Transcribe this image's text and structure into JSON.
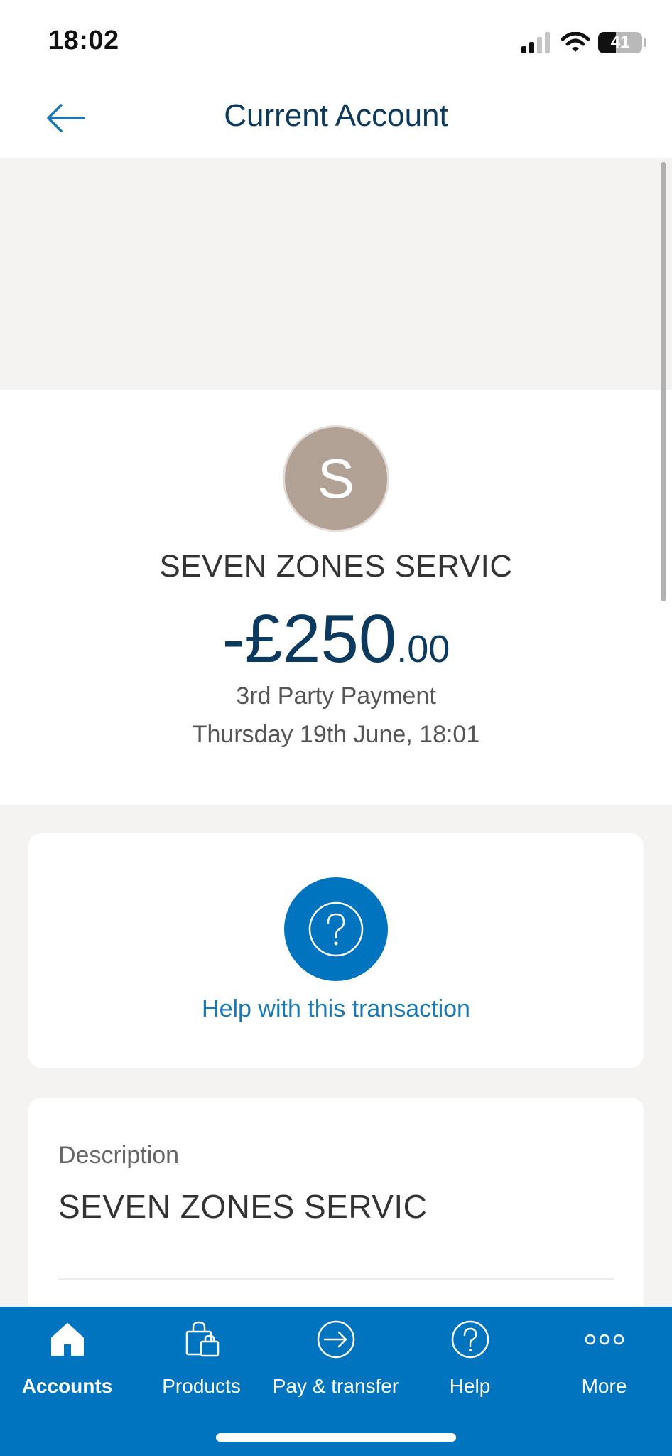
{
  "status_bar": {
    "time": "18:02",
    "battery": "41",
    "battery_level": 0.41
  },
  "header": {
    "title": "Current Account",
    "back_icon": "arrow-left-icon"
  },
  "transaction": {
    "avatar_letter": "S",
    "merchant": "SEVEN ZONES SERVIC",
    "amount_main": "-£250",
    "amount_pence": ".00",
    "type": "3rd Party Payment",
    "date": "Thursday 19th June, 18:01"
  },
  "help": {
    "label": "Help with this transaction",
    "icon": "question-circle-icon"
  },
  "details": {
    "description_label": "Description",
    "description_value": "SEVEN ZONES SERVIC"
  },
  "tabs": [
    {
      "label": "Accounts",
      "icon": "home-icon",
      "active": true
    },
    {
      "label": "Products",
      "icon": "shopping-bag-icon",
      "active": false
    },
    {
      "label": "Pay & transfer",
      "icon": "arrow-circle-right-icon",
      "active": false
    },
    {
      "label": "Help",
      "icon": "question-circle-icon",
      "active": false
    },
    {
      "label": "More",
      "icon": "more-dots-icon",
      "active": false
    }
  ],
  "colors": {
    "brand_blue": "#0074bf",
    "navy_text": "#0b3a5e",
    "avatar_bg": "#b2a296",
    "page_bg": "#f4f3f2"
  }
}
